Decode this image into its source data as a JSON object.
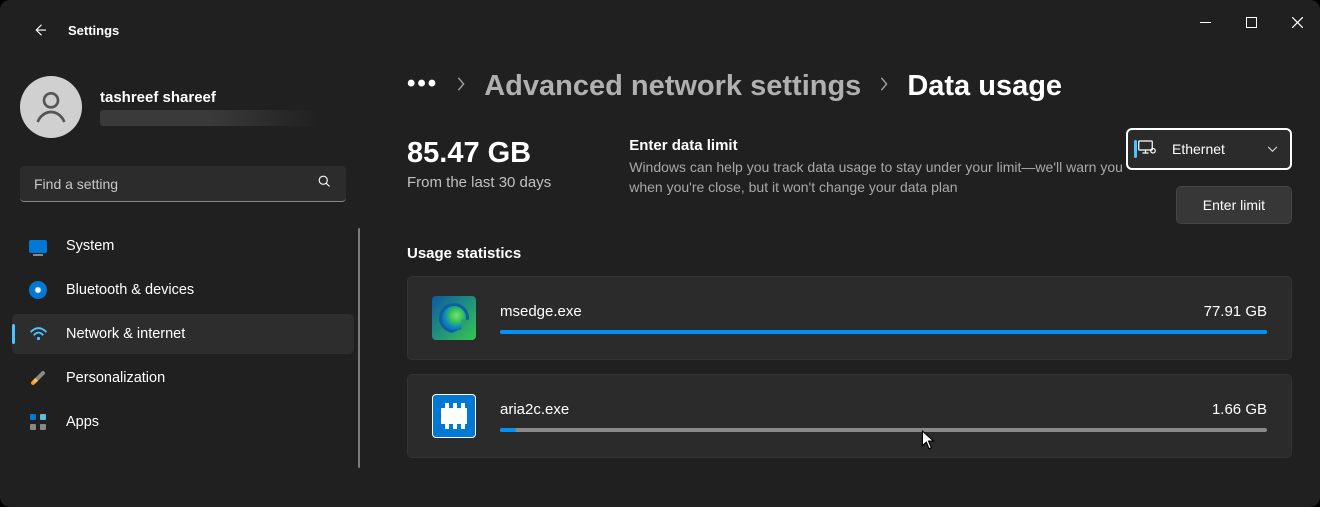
{
  "app": {
    "title": "Settings"
  },
  "profile": {
    "name": "tashreef shareef"
  },
  "search": {
    "placeholder": "Find a setting"
  },
  "sidebar": {
    "items": [
      {
        "label": "System"
      },
      {
        "label": "Bluetooth & devices"
      },
      {
        "label": "Network & internet"
      },
      {
        "label": "Personalization"
      },
      {
        "label": "Apps"
      }
    ],
    "selected_index": 2
  },
  "breadcrumb": {
    "more": "•••",
    "parent": "Advanced network settings",
    "current": "Data usage"
  },
  "usage": {
    "total": "85.47 GB",
    "period": "From the last 30 days"
  },
  "data_limit": {
    "title": "Enter data limit",
    "description": "Windows can help you track data usage to stay under your limit—we'll warn you when you're close, but it won't change your data plan",
    "button_label": "Enter limit"
  },
  "network_selector": {
    "label": "Ethernet"
  },
  "stats": {
    "title": "Usage statistics",
    "items": [
      {
        "name": "msedge.exe",
        "value": "77.91 GB",
        "percent": 100,
        "icon": "edge"
      },
      {
        "name": "aria2c.exe",
        "value": "1.66 GB",
        "percent": 2.1,
        "icon": "generic"
      }
    ]
  }
}
